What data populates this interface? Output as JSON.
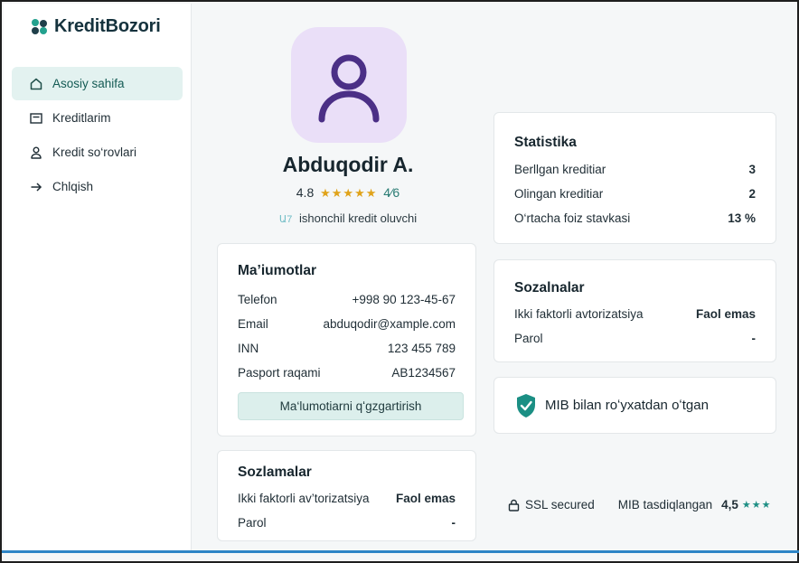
{
  "brand": {
    "name": "KreditBozori"
  },
  "sidebar": {
    "items": [
      {
        "label": "Asosiy sahifa",
        "icon": "home-icon",
        "active": true
      },
      {
        "label": "Kreditlarim",
        "icon": "credit-card-icon",
        "active": false
      },
      {
        "label": "Kredit so‘rovlari",
        "icon": "user-icon",
        "active": false
      },
      {
        "label": "Chlqish",
        "icon": "arrow-right-icon",
        "active": false
      }
    ]
  },
  "profile": {
    "name": "Abduqodir A.",
    "rating": "4.8",
    "stars": "★★★★★",
    "reviews": "4⁄6",
    "tagline_mark": "Ա7",
    "tagline": "ishonchil kredit oluvchi"
  },
  "info_card": {
    "title": "Ma’iumotlar",
    "rows": [
      {
        "label": "Telefon",
        "value": "+998 90 123-45-67"
      },
      {
        "label": "Email",
        "value": "abduqodir@xample.com"
      },
      {
        "label": "INN",
        "value": "123 455 789"
      },
      {
        "label": "Pasport raqami",
        "value": "AB1234567"
      }
    ],
    "edit_button": "Ma‘lumotiarni qʻgzgartirish"
  },
  "settings_left": {
    "title": "Sozlamalar",
    "rows": [
      {
        "label": "Ikki faktorli av’torizatsiya",
        "value": "Faol emas"
      },
      {
        "label": "Parol",
        "value": "-"
      }
    ]
  },
  "stats_card": {
    "title": "Statistika",
    "rows": [
      {
        "label": "Berllgan kreditiar",
        "value": "3"
      },
      {
        "label": "Olingan kreditiar",
        "value": "2"
      },
      {
        "label": "O‘rtacha foiz stavkasi",
        "value": "13 %"
      }
    ]
  },
  "settings_right": {
    "title": "Sozalnalar",
    "rows": [
      {
        "label": "Ikki faktorli avtorizatsiya",
        "value": "Faol emas"
      },
      {
        "label": "Parol",
        "value": "-"
      }
    ]
  },
  "mib_card": {
    "text": "MIB bilan roʻyxatdan oʻtgan",
    "icon": "shield-check-icon"
  },
  "footer": {
    "ssl": "SSL secured",
    "mib": "MIB tasdiqlangan",
    "score": "4,5",
    "stars": "★★★"
  },
  "colors": {
    "accent": "#1a8a7a",
    "active_bg": "#e3f2f0",
    "star": "#e0a31a",
    "avatar_bg": "#eadff8"
  }
}
